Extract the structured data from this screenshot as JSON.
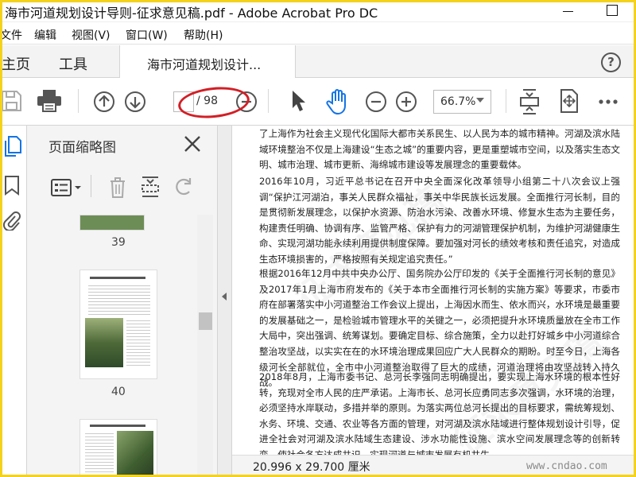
{
  "window": {
    "title": "海市河道规划设计导则-征求意见稿.pdf - Adobe Acrobat Pro DC"
  },
  "menu": [
    "文件",
    "编辑",
    "视图(V)",
    "窗口(W)",
    "帮助(H)"
  ],
  "tabs": {
    "home": "主页",
    "tools": "工具",
    "document": "海市河道规划设计..."
  },
  "help_label": "?",
  "toolbar": {
    "page_current": "",
    "page_total": "/ 98",
    "zoom": "66.7%"
  },
  "panel": {
    "title": "页面缩略图",
    "thumbnails": [
      {
        "page": "39"
      },
      {
        "page": "40"
      }
    ]
  },
  "document": {
    "paragraphs": [
      "了上海作为社会主义现代化国际大都市关系民生、以人民为本的城市精神。河湖及滨水陆域环境整治不仅是上海建设“生态之城”的重要内容，更是重塑城市空间，以及落实生态文明、城市治理、城市更新、海绵城市建设等发展理念的重要载体。",
      "2016年10月，习近平总书记在召开中央全面深化改革领导小组第二十八次会议上强调“保护江河湖泊，事关人民群众福祉，事关中华民族长远发展。全面推行河长制，目的是贯彻新发展理念，以保护水资源、防治水污染、改善水环境、修复水生态为主要任务，构建责任明确、协调有序、监管严格、保护有力的河湖管理保护机制，为维护河湖健康生命、实现河湖功能永续利用提供制度保障。要加强对河长的绩效考核和责任追究，对造成生态环境损害的，严格按照有关规定追究责任。”",
      "根据2016年12月中共中央办公厅、国务院办公厅印发的《关于全面推行河长制的意见》及2017年1月上海市府发布的《关于本市全面推行河长制的实施方案》等要求，市委市府在部署落实中小河道整治工作会议上提出，上海因水而生、依水而兴，水环境是最重要的发展基础之一，是检验城市管理水平的关键之一，必须把提升水环境质量放在全市工作大局中，突出强调、统筹谋划。要确定目标、综合施策，全力以赴打好城乡中小河道综合整治攻坚战，以实实在在的水环境治理成果回应广大人民群众的期盼。时至今日，上海各级河长全部就位，全市中小河道整治取得了巨大的成绩，河道治理将由攻坚战转入持久战。",
      "2018年8月，上海市委书记、总河长李强同志明确提出，要实现上海水环境的根本性好转，充现对全市人民的庄严承诺。上海市长、总河长应勇同志多次强调，水环境的治理，必须坚持水岸联动，多措并举的原则。为落实两位总河长提出的目标要求，需统筹规划、水务、环境、交通、农业等各方面的管理，对河湖及滨水陆域进行整体规划设计引导，促进全社会对河湖及滨水陆域生态建设、涉水功能性设施、滨水空间发展理念等的创新转变，使社会各方达成共识，实现河道与城市发展有机共生。"
    ]
  },
  "status": {
    "dimensions": "20.996 x 29.700 厘米",
    "site": "www.cndao.com"
  },
  "colors": {
    "accent": "#1473e6",
    "annotation": "#d21f26",
    "frame": "#f4d21c"
  }
}
